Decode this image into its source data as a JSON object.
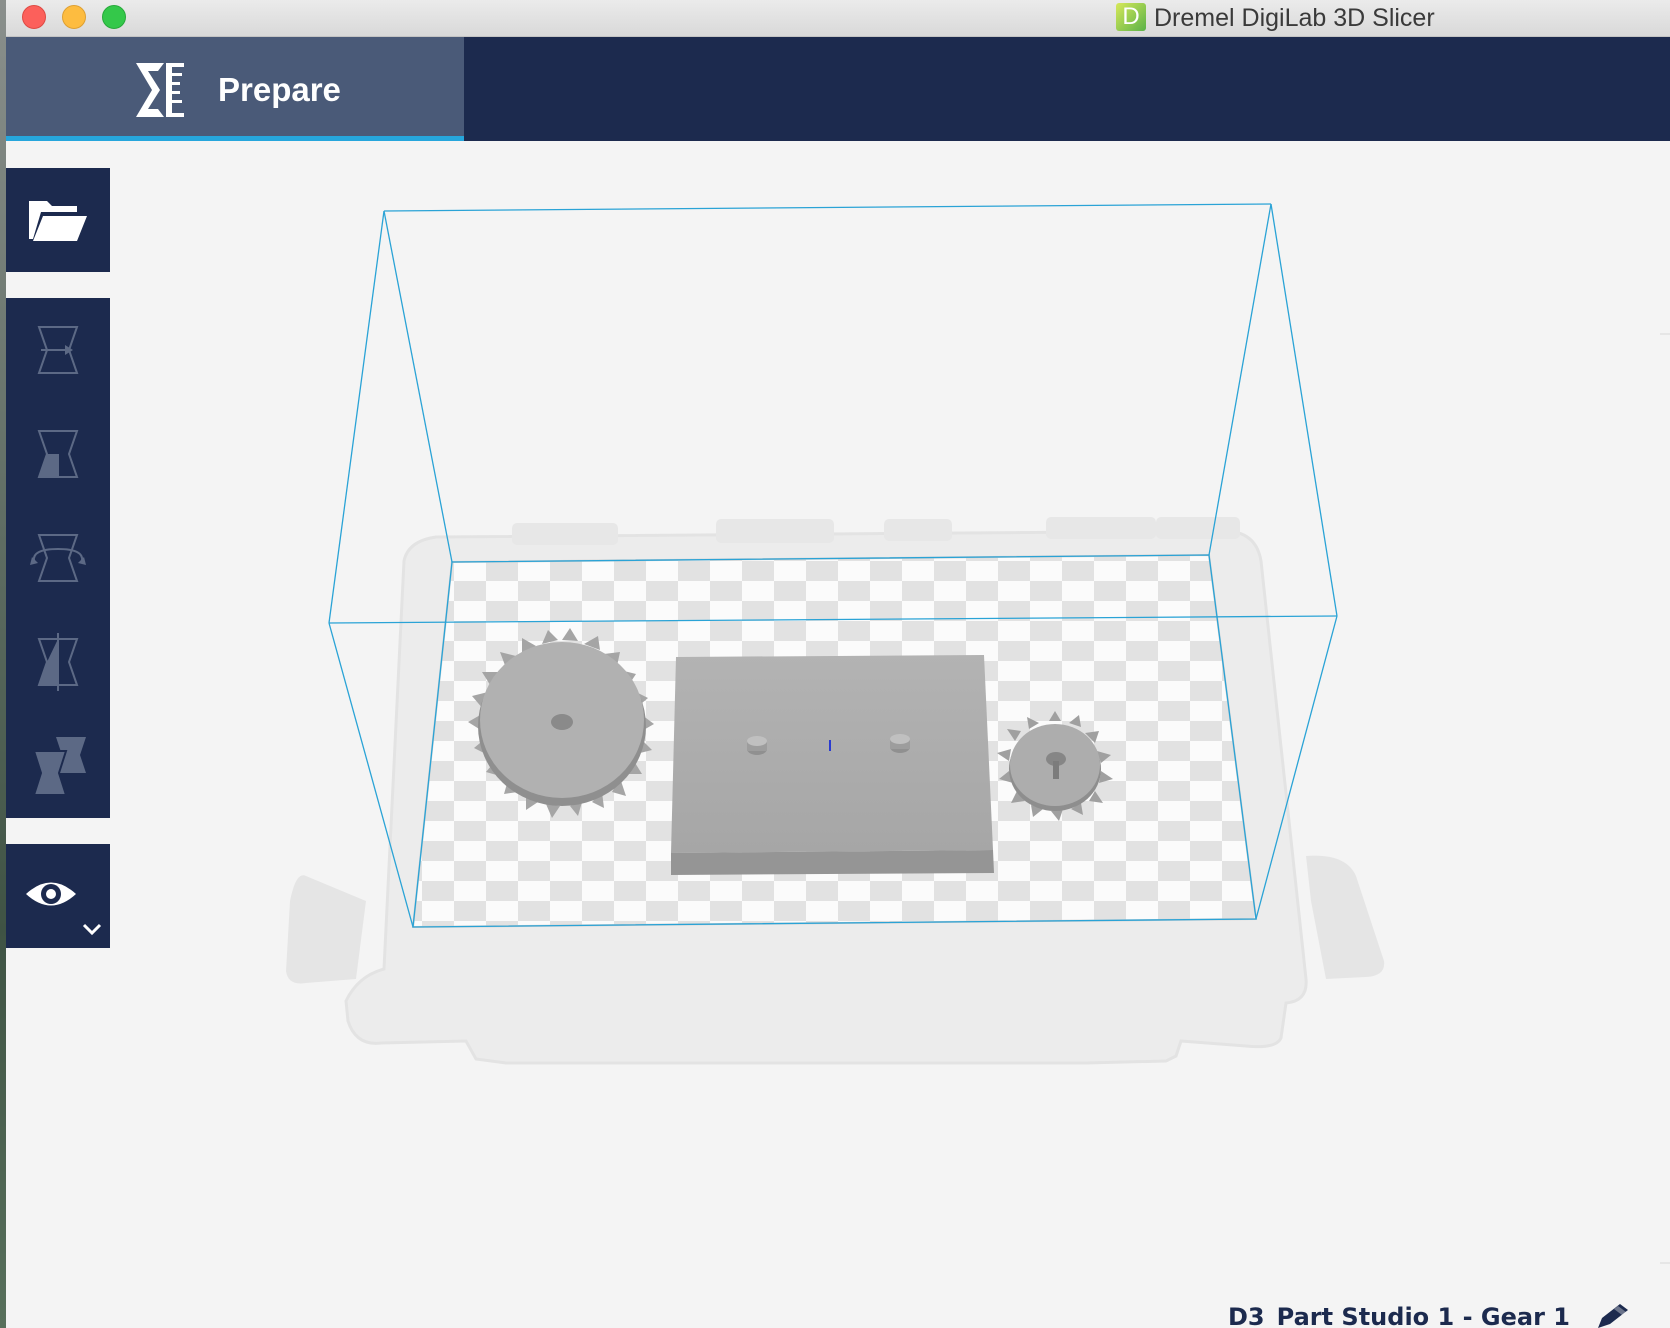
{
  "window": {
    "app_badge_letter": "D",
    "title": "Dremel DigiLab 3D Slicer"
  },
  "header": {
    "stage_tab_label": "Prepare",
    "stage_icon": "prepare-stage-icon"
  },
  "toolbar": {
    "open_icon": "folder-open-icon",
    "tools": [
      {
        "name": "move-tool",
        "icon": "move-icon"
      },
      {
        "name": "scale-tool",
        "icon": "scale-icon"
      },
      {
        "name": "rotate-tool",
        "icon": "rotate-icon"
      },
      {
        "name": "mirror-tool",
        "icon": "mirror-icon"
      },
      {
        "name": "per-model-settings-tool",
        "icon": "per-model-settings-icon"
      }
    ],
    "view_icon": "eye-icon",
    "view_dropdown_icon": "chevron-down-icon"
  },
  "scene": {
    "objects": [
      "gear-large",
      "base-plate",
      "gear-small"
    ]
  },
  "footer": {
    "file_name": "D3_Part Studio 1 - Gear 1",
    "edit_icon": "pencil-icon"
  },
  "colors": {
    "header_bg": "#1c2a4e",
    "active_tab_bg": "#4a5a78",
    "active_tab_underline": "#26a6dc",
    "build_volume_lines": "#2aa3d6",
    "model_gray": "#a8a8a8",
    "viewport_bg": "#f4f4f4"
  }
}
